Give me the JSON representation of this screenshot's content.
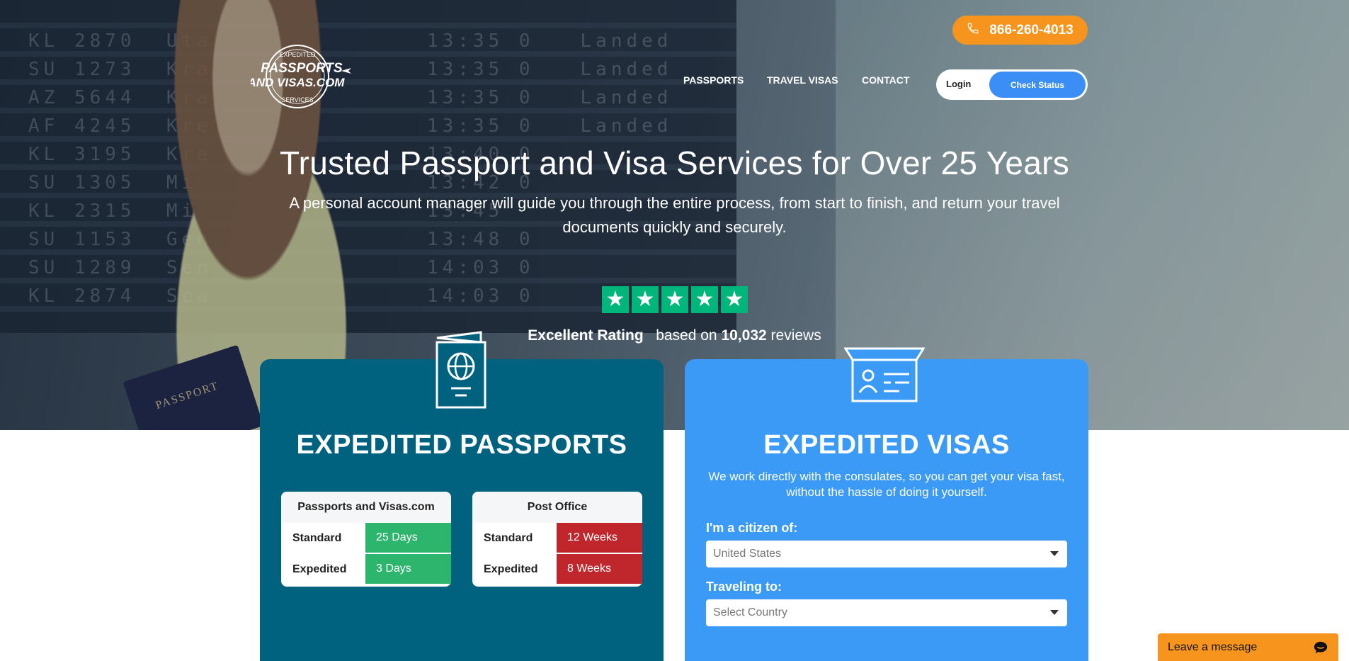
{
  "header": {
    "logo_alt": "Passports and Visas.com Expedited Services",
    "phone": "866-260-4013",
    "nav": [
      "PASSPORTS",
      "TRAVEL VISAS",
      "CONTACT"
    ],
    "login_label": "Login",
    "check_status_label": "Check Status"
  },
  "hero": {
    "title": "Trusted Passport and Visa Services for Over 25 Years",
    "subtitle": "A personal account manager will guide you through the entire process, from start to finish, and return your travel documents quickly and securely.",
    "rating_label": "Excellent Rating",
    "rating_based_on": "based on",
    "rating_count": "10,032",
    "rating_reviews": "reviews",
    "stars": 5
  },
  "passports_card": {
    "title": "EXPEDITED PASSPORTS",
    "ours": {
      "header": "Passports and Visas.com",
      "rows": [
        {
          "label": "Standard",
          "value": "25 Days"
        },
        {
          "label": "Expedited",
          "value": "3 Days"
        }
      ]
    },
    "post_office": {
      "header": "Post Office",
      "rows": [
        {
          "label": "Standard",
          "value": "12 Weeks"
        },
        {
          "label": "Expedited",
          "value": "8 Weeks"
        }
      ]
    }
  },
  "visas_card": {
    "title": "EXPEDITED VISAS",
    "description": "We work directly with the consulates, so you can get your visa fast, without the hassle of doing it yourself.",
    "citizen_label": "I'm a citizen of:",
    "citizen_value": "United States",
    "traveling_label": "Traveling to:",
    "traveling_placeholder": "Select Country"
  },
  "chat": {
    "label": "Leave a message"
  },
  "colors": {
    "accent_orange": "#f7941d",
    "passport_card": "#00627f",
    "visa_card": "#3a9af5",
    "trustpilot_green": "#00b67a",
    "good": "#2db46d",
    "bad": "#c0272d"
  }
}
